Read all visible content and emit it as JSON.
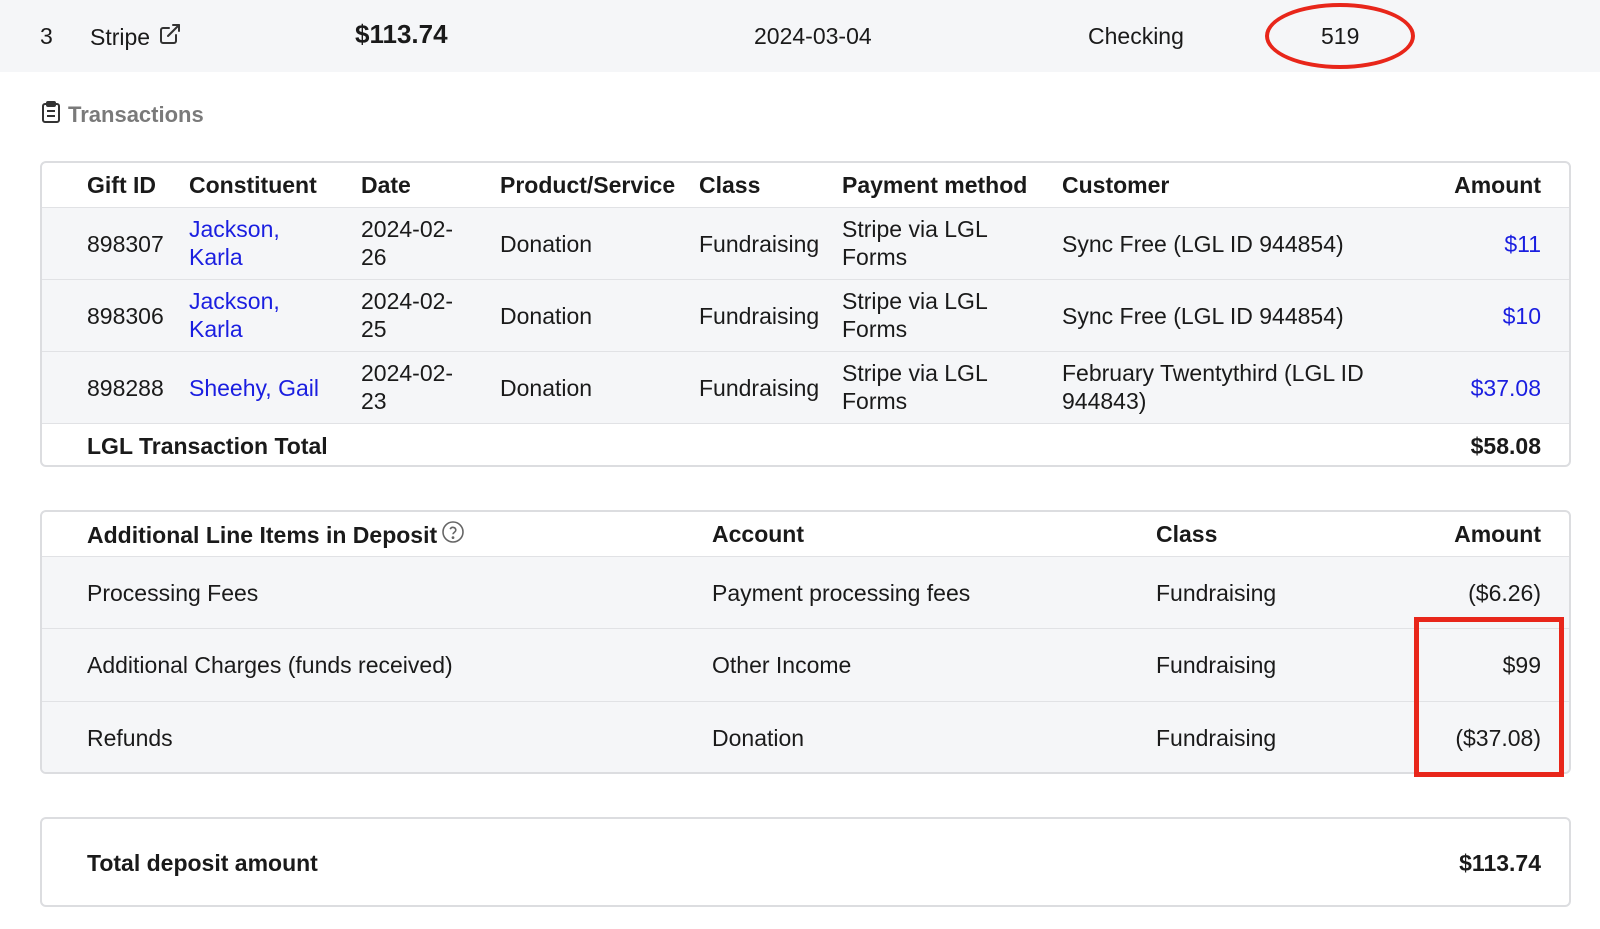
{
  "summary_row": {
    "number": "3",
    "name": "Stripe",
    "amount": "$113.74",
    "date": "2024-03-04",
    "account": "Checking",
    "reference": "519"
  },
  "section": {
    "title": "Transactions",
    "icon": "clipboard-icon"
  },
  "transactions": {
    "headers": {
      "gift_id": "Gift ID",
      "constituent": "Constituent",
      "date": "Date",
      "product": "Product/Service",
      "class": "Class",
      "payment_method": "Payment method",
      "customer": "Customer",
      "amount": "Amount"
    },
    "rows": [
      {
        "gift_id": "898307",
        "constituent_line1": "Jackson,",
        "constituent_line2": "Karla",
        "date_line1": "2024-02-",
        "date_line2": "26",
        "product": "Donation",
        "class": "Fundraising",
        "payment_line1": "Stripe via LGL",
        "payment_line2": "Forms",
        "customer_line1": "Sync Free (LGL ID 944854)",
        "customer_line2": "",
        "amount": "$11"
      },
      {
        "gift_id": "898306",
        "constituent_line1": "Jackson,",
        "constituent_line2": "Karla",
        "date_line1": "2024-02-",
        "date_line2": "25",
        "product": "Donation",
        "class": "Fundraising",
        "payment_line1": "Stripe via LGL",
        "payment_line2": "Forms",
        "customer_line1": "Sync Free (LGL ID 944854)",
        "customer_line2": "",
        "amount": "$10"
      },
      {
        "gift_id": "898288",
        "constituent_line1": "Sheehy, Gail",
        "constituent_line2": "",
        "date_line1": "2024-02-",
        "date_line2": "23",
        "product": "Donation",
        "class": "Fundraising",
        "payment_line1": "Stripe via LGL",
        "payment_line2": "Forms",
        "customer_line1": "February Twentythird (LGL ID",
        "customer_line2": "944843)",
        "amount": "$37.08"
      }
    ],
    "total_label": "LGL Transaction Total",
    "total_value": "$58.08"
  },
  "additional": {
    "headers": {
      "item": "Additional Line Items in Deposit",
      "account": "Account",
      "class": "Class",
      "amount": "Amount"
    },
    "rows": [
      {
        "item": "Processing Fees",
        "account": "Payment processing fees",
        "class": "Fundraising",
        "amount": "($6.26)"
      },
      {
        "item": "Additional Charges (funds received)",
        "account": "Other Income",
        "class": "Fundraising",
        "amount": "$99"
      },
      {
        "item": "Refunds",
        "account": "Donation",
        "class": "Fundraising",
        "amount": "($37.08)"
      }
    ]
  },
  "deposit_total": {
    "label": "Total deposit amount",
    "value": "$113.74"
  },
  "colors": {
    "link": "#1a1ee0",
    "annotation": "#e8261a",
    "row_alt": "#f5f6f8"
  }
}
